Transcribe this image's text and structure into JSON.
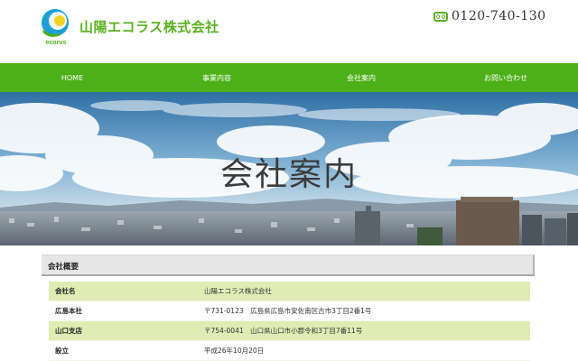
{
  "header": {
    "company_name": "山陽エコラス株式会社",
    "logo_text": "ecorus",
    "phone_icon": "free-dial-icon",
    "phone_number": "0120-740-130"
  },
  "colors": {
    "brand_green": "#4eb018",
    "table_row_green": "#e0ecb4",
    "logo_blue": "#1aa0d8",
    "logo_yellow": "#f6d21a"
  },
  "nav": {
    "items": [
      {
        "label": "HOME"
      },
      {
        "label": "事業内容"
      },
      {
        "label": "会社案内"
      },
      {
        "label": "お問い合わせ"
      }
    ]
  },
  "hero": {
    "title": "会社案内"
  },
  "overview": {
    "heading": "会社概要",
    "rows": [
      {
        "label": "会社名",
        "value": "山陽エコラス株式会社"
      },
      {
        "label": "広島本社",
        "value": "〒731-0123　広島県広島市安佐南区古市3丁目2番1号"
      },
      {
        "label": "山口支店",
        "value": "〒754-0041　山口県山口市小郡令和3丁目7番11号"
      },
      {
        "label": "設立",
        "value": "平成26年10月20日"
      }
    ]
  }
}
